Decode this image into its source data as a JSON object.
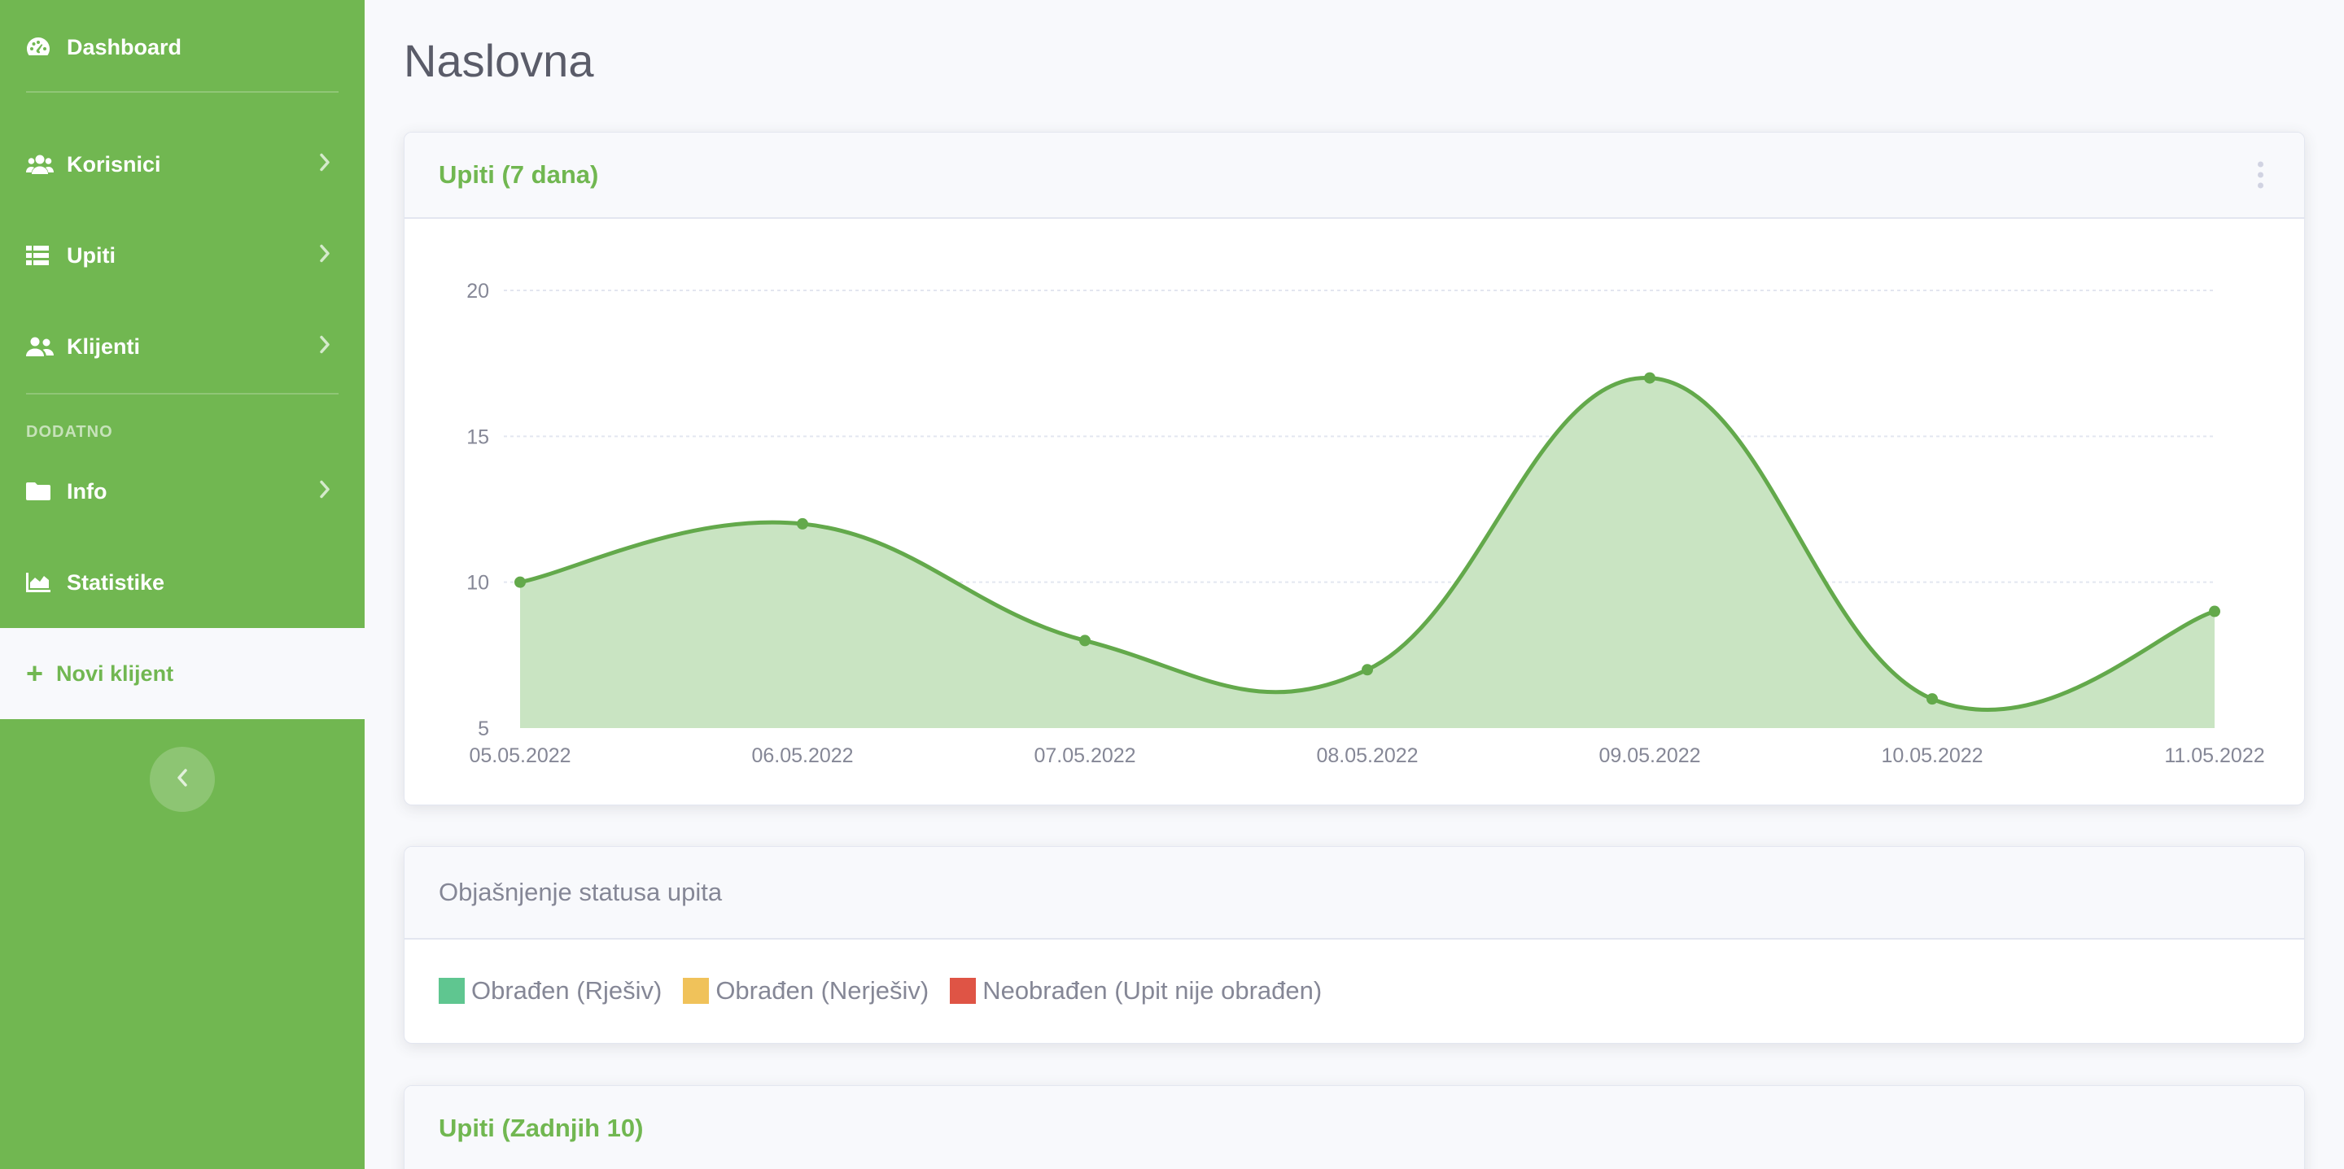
{
  "sidebar": {
    "brand": "Dashboard",
    "items": [
      {
        "label": "Korisnici",
        "icon": "users-icon"
      },
      {
        "label": "Upiti",
        "icon": "table-icon"
      },
      {
        "label": "Klijenti",
        "icon": "user-friends-icon"
      }
    ],
    "section_heading": "DODATNO",
    "extra_items": [
      {
        "label": "Info",
        "icon": "folder-icon"
      },
      {
        "label": "Statistike",
        "icon": "chart-area-icon"
      }
    ],
    "new_client": "Novi klijent",
    "accent": "#71b751"
  },
  "page": {
    "title": "Naslovna"
  },
  "chart_card": {
    "title": "Upiti (7 dana)"
  },
  "chart_data": {
    "type": "area",
    "x": [
      "05.05.2022",
      "06.05.2022",
      "07.05.2022",
      "08.05.2022",
      "09.05.2022",
      "10.05.2022",
      "11.05.2022"
    ],
    "values": [
      10,
      12,
      8,
      7,
      17,
      6,
      9
    ],
    "ylim": [
      5,
      20
    ],
    "yticks": [
      5,
      10,
      15,
      20
    ],
    "grid": true,
    "line_color": "#63a94b",
    "fill_color": "#c9e4c2"
  },
  "status_card": {
    "title": "Objašnjenje statusa upita",
    "legend": [
      {
        "label": "Obrađen (Rješiv)",
        "color": "#5fc690"
      },
      {
        "label": "Obrađen (Nerješiv)",
        "color": "#f0c25a"
      },
      {
        "label": "Neobrađen (Upit nije obrađen)",
        "color": "#df5445"
      }
    ]
  },
  "last_card": {
    "title": "Upiti (Zadnjih 10)"
  }
}
